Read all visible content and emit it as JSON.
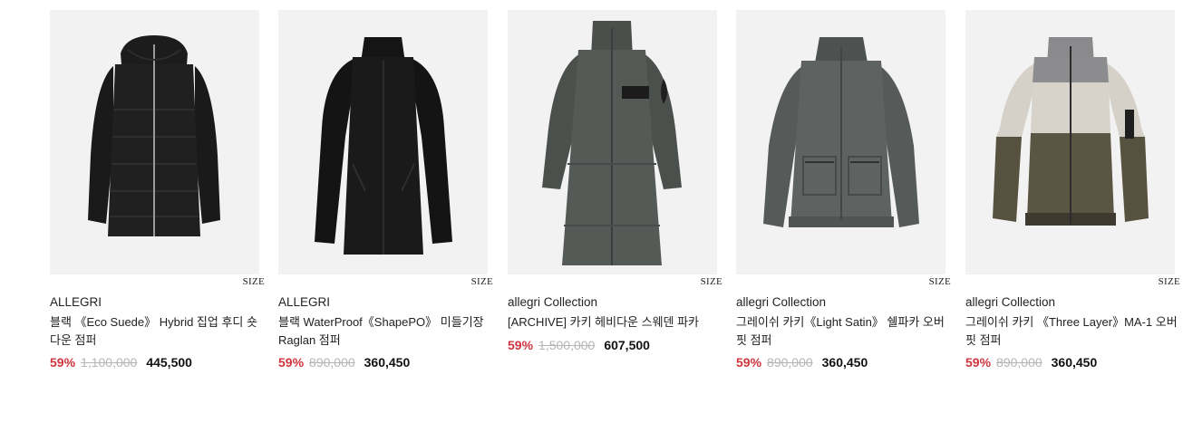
{
  "labels": {
    "size": "SIZE"
  },
  "colors": {
    "discount": "#d0343d",
    "original_price": "#b5b5b5",
    "image_bg": "#f2f2f2"
  },
  "products": [
    {
      "brand": "ALLEGRI",
      "name": "블랙 《Eco Suede》 Hybrid 집업 후디 숏다운 점퍼",
      "discount": "59%",
      "original_price": "1,100,000",
      "price": "445,500",
      "image": "black hooded hybrid puffer jacket"
    },
    {
      "brand": "ALLEGRI",
      "name": "블랙 WaterProof《ShapePO》 미들기장 Raglan 점퍼",
      "discount": "59%",
      "original_price": "890,000",
      "price": "360,450",
      "image": "black mid-length raglan jacket"
    },
    {
      "brand": "allegri Collection",
      "name": "[ARCHIVE] 카키 헤비다운 스웨덴 파카",
      "discount": "59%",
      "original_price": "1,500,000",
      "price": "607,500",
      "image": "khaki long down parka"
    },
    {
      "brand": "allegri Collection",
      "name": "그레이쉬 카키《Light Satin》 쉘파카 오버핏 점퍼",
      "discount": "59%",
      "original_price": "890,000",
      "price": "360,450",
      "image": "grayish khaki satin overfit jacket"
    },
    {
      "brand": "allegri Collection",
      "name": "그레이쉬 카키 《Three Layer》MA-1 오버핏 점퍼",
      "discount": "59%",
      "original_price": "890,000",
      "price": "360,450",
      "image": "three-tone MA-1 bomber jacket"
    }
  ]
}
